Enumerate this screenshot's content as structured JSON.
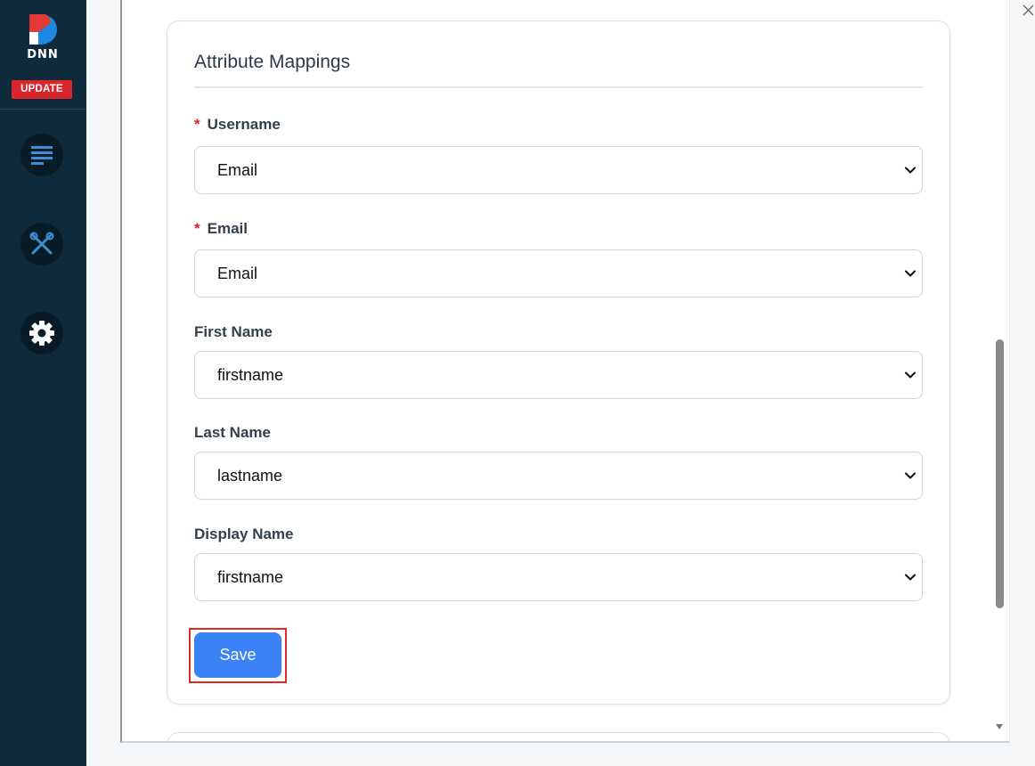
{
  "sidebar": {
    "logo_text": "DNN",
    "update_label": "UPDATE",
    "items": [
      {
        "icon": "content-list-icon"
      },
      {
        "icon": "tools-icon"
      },
      {
        "icon": "gear-icon"
      }
    ]
  },
  "card": {
    "title": "Attribute Mappings",
    "fields": [
      {
        "label": "Username",
        "required_mark": "*",
        "value": "Email"
      },
      {
        "label": "Email",
        "required_mark": "*",
        "value": "Email"
      },
      {
        "label": "First Name",
        "value": "firstname"
      },
      {
        "label": "Last Name",
        "value": "lastname"
      },
      {
        "label": "Display Name",
        "value": "firstname"
      }
    ],
    "save_label": "Save"
  },
  "colors": {
    "sidebar_bg": "#0f2a3a",
    "update_badge": "#d9262c",
    "save_button": "#3b82f6",
    "highlight_outline": "#e02a2a",
    "required_mark": "#d9262c"
  }
}
